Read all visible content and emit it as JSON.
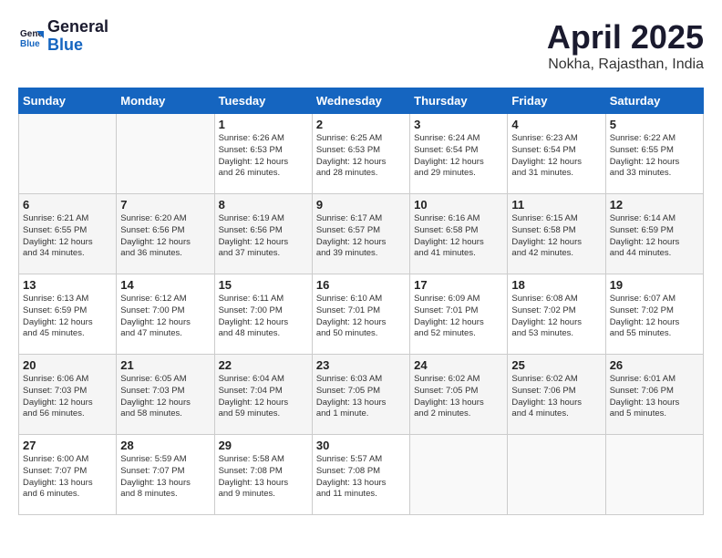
{
  "header": {
    "logo_line1": "General",
    "logo_line2": "Blue",
    "month_title": "April 2025",
    "location": "Nokha, Rajasthan, India"
  },
  "days_of_week": [
    "Sunday",
    "Monday",
    "Tuesday",
    "Wednesday",
    "Thursday",
    "Friday",
    "Saturday"
  ],
  "weeks": [
    [
      {
        "day": "",
        "info": ""
      },
      {
        "day": "",
        "info": ""
      },
      {
        "day": "1",
        "info": "Sunrise: 6:26 AM\nSunset: 6:53 PM\nDaylight: 12 hours\nand 26 minutes."
      },
      {
        "day": "2",
        "info": "Sunrise: 6:25 AM\nSunset: 6:53 PM\nDaylight: 12 hours\nand 28 minutes."
      },
      {
        "day": "3",
        "info": "Sunrise: 6:24 AM\nSunset: 6:54 PM\nDaylight: 12 hours\nand 29 minutes."
      },
      {
        "day": "4",
        "info": "Sunrise: 6:23 AM\nSunset: 6:54 PM\nDaylight: 12 hours\nand 31 minutes."
      },
      {
        "day": "5",
        "info": "Sunrise: 6:22 AM\nSunset: 6:55 PM\nDaylight: 12 hours\nand 33 minutes."
      }
    ],
    [
      {
        "day": "6",
        "info": "Sunrise: 6:21 AM\nSunset: 6:55 PM\nDaylight: 12 hours\nand 34 minutes."
      },
      {
        "day": "7",
        "info": "Sunrise: 6:20 AM\nSunset: 6:56 PM\nDaylight: 12 hours\nand 36 minutes."
      },
      {
        "day": "8",
        "info": "Sunrise: 6:19 AM\nSunset: 6:56 PM\nDaylight: 12 hours\nand 37 minutes."
      },
      {
        "day": "9",
        "info": "Sunrise: 6:17 AM\nSunset: 6:57 PM\nDaylight: 12 hours\nand 39 minutes."
      },
      {
        "day": "10",
        "info": "Sunrise: 6:16 AM\nSunset: 6:58 PM\nDaylight: 12 hours\nand 41 minutes."
      },
      {
        "day": "11",
        "info": "Sunrise: 6:15 AM\nSunset: 6:58 PM\nDaylight: 12 hours\nand 42 minutes."
      },
      {
        "day": "12",
        "info": "Sunrise: 6:14 AM\nSunset: 6:59 PM\nDaylight: 12 hours\nand 44 minutes."
      }
    ],
    [
      {
        "day": "13",
        "info": "Sunrise: 6:13 AM\nSunset: 6:59 PM\nDaylight: 12 hours\nand 45 minutes."
      },
      {
        "day": "14",
        "info": "Sunrise: 6:12 AM\nSunset: 7:00 PM\nDaylight: 12 hours\nand 47 minutes."
      },
      {
        "day": "15",
        "info": "Sunrise: 6:11 AM\nSunset: 7:00 PM\nDaylight: 12 hours\nand 48 minutes."
      },
      {
        "day": "16",
        "info": "Sunrise: 6:10 AM\nSunset: 7:01 PM\nDaylight: 12 hours\nand 50 minutes."
      },
      {
        "day": "17",
        "info": "Sunrise: 6:09 AM\nSunset: 7:01 PM\nDaylight: 12 hours\nand 52 minutes."
      },
      {
        "day": "18",
        "info": "Sunrise: 6:08 AM\nSunset: 7:02 PM\nDaylight: 12 hours\nand 53 minutes."
      },
      {
        "day": "19",
        "info": "Sunrise: 6:07 AM\nSunset: 7:02 PM\nDaylight: 12 hours\nand 55 minutes."
      }
    ],
    [
      {
        "day": "20",
        "info": "Sunrise: 6:06 AM\nSunset: 7:03 PM\nDaylight: 12 hours\nand 56 minutes."
      },
      {
        "day": "21",
        "info": "Sunrise: 6:05 AM\nSunset: 7:03 PM\nDaylight: 12 hours\nand 58 minutes."
      },
      {
        "day": "22",
        "info": "Sunrise: 6:04 AM\nSunset: 7:04 PM\nDaylight: 12 hours\nand 59 minutes."
      },
      {
        "day": "23",
        "info": "Sunrise: 6:03 AM\nSunset: 7:05 PM\nDaylight: 13 hours\nand 1 minute."
      },
      {
        "day": "24",
        "info": "Sunrise: 6:02 AM\nSunset: 7:05 PM\nDaylight: 13 hours\nand 2 minutes."
      },
      {
        "day": "25",
        "info": "Sunrise: 6:02 AM\nSunset: 7:06 PM\nDaylight: 13 hours\nand 4 minutes."
      },
      {
        "day": "26",
        "info": "Sunrise: 6:01 AM\nSunset: 7:06 PM\nDaylight: 13 hours\nand 5 minutes."
      }
    ],
    [
      {
        "day": "27",
        "info": "Sunrise: 6:00 AM\nSunset: 7:07 PM\nDaylight: 13 hours\nand 6 minutes."
      },
      {
        "day": "28",
        "info": "Sunrise: 5:59 AM\nSunset: 7:07 PM\nDaylight: 13 hours\nand 8 minutes."
      },
      {
        "day": "29",
        "info": "Sunrise: 5:58 AM\nSunset: 7:08 PM\nDaylight: 13 hours\nand 9 minutes."
      },
      {
        "day": "30",
        "info": "Sunrise: 5:57 AM\nSunset: 7:08 PM\nDaylight: 13 hours\nand 11 minutes."
      },
      {
        "day": "",
        "info": ""
      },
      {
        "day": "",
        "info": ""
      },
      {
        "day": "",
        "info": ""
      }
    ]
  ]
}
